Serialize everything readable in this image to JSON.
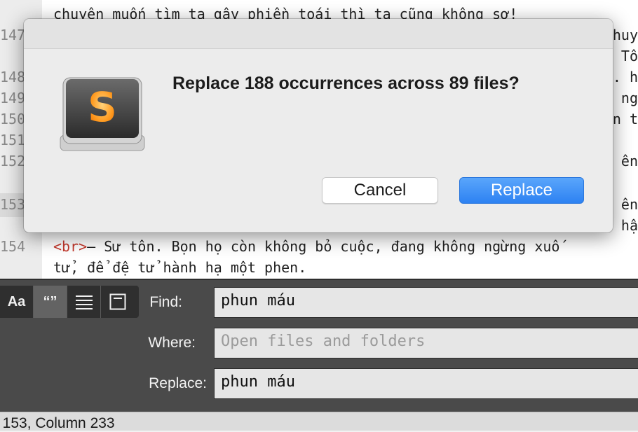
{
  "editor": {
    "line_numbers": [
      "147",
      "148",
      "149",
      "150",
      "151",
      "152",
      "153",
      "154"
    ],
    "lines_left": [
      "chuyên muốn tìm ta gây phiền toái thì ta cũng không sợ!",
      "– Sư tôn. Bọn họ còn không bỏ cuộc, đang không ngừng xuố",
      "tử, để đệ tử hành hạ một phen."
    ],
    "line_154_tag": "<br>",
    "lines_right": [
      "huy",
      "Tố",
      ". h",
      "ng",
      "n t",
      "ên",
      "ên",
      "hậ"
    ]
  },
  "dialog": {
    "icon": "sublime-text-icon",
    "icon_letter": "S",
    "message": "Replace 188 occurrences across 89 files?",
    "cancel_label": "Cancel",
    "replace_label": "Replace",
    "accent_color": "#2d82f2"
  },
  "find_panel": {
    "options": {
      "case_label": "Aa",
      "whole_word_label": "“”",
      "wrap_icon": "lines-icon",
      "context_icon": "context-icon"
    },
    "find_label": "Find:",
    "find_value": "phun máu",
    "where_label": "Where:",
    "where_placeholder": "Open files and folders",
    "replace_label": "Replace:",
    "replace_value": "phun máu"
  },
  "status_bar": {
    "text": ", 153, Column 233"
  }
}
